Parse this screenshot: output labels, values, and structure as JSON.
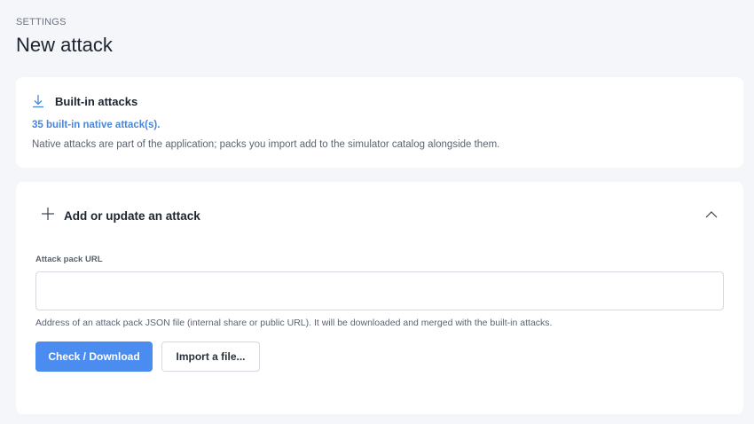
{
  "header": {
    "eyebrow": "SETTINGS",
    "title": "New attack"
  },
  "builtin": {
    "icon": "download-icon",
    "title": "Built-in attacks",
    "count_text": "35 built-in native attack(s).",
    "description": "Native attacks are part of the application; packs you import add to the simulator catalog alongside them."
  },
  "add_section": {
    "icon": "plus-icon",
    "title": "Add or update an attack",
    "collapse_icon": "chevron-up-icon",
    "url_label": "Attack pack URL",
    "url_value": "",
    "url_placeholder": "",
    "help_text": "Address of an attack pack JSON file (internal share or public URL). It will be downloaded and merged with the built-in attacks.",
    "primary_button": "Check / Download",
    "secondary_button": "Import a file..."
  },
  "colors": {
    "accent": "#4a8cf0",
    "link": "#4a86d8",
    "background": "#f4f6fa"
  }
}
